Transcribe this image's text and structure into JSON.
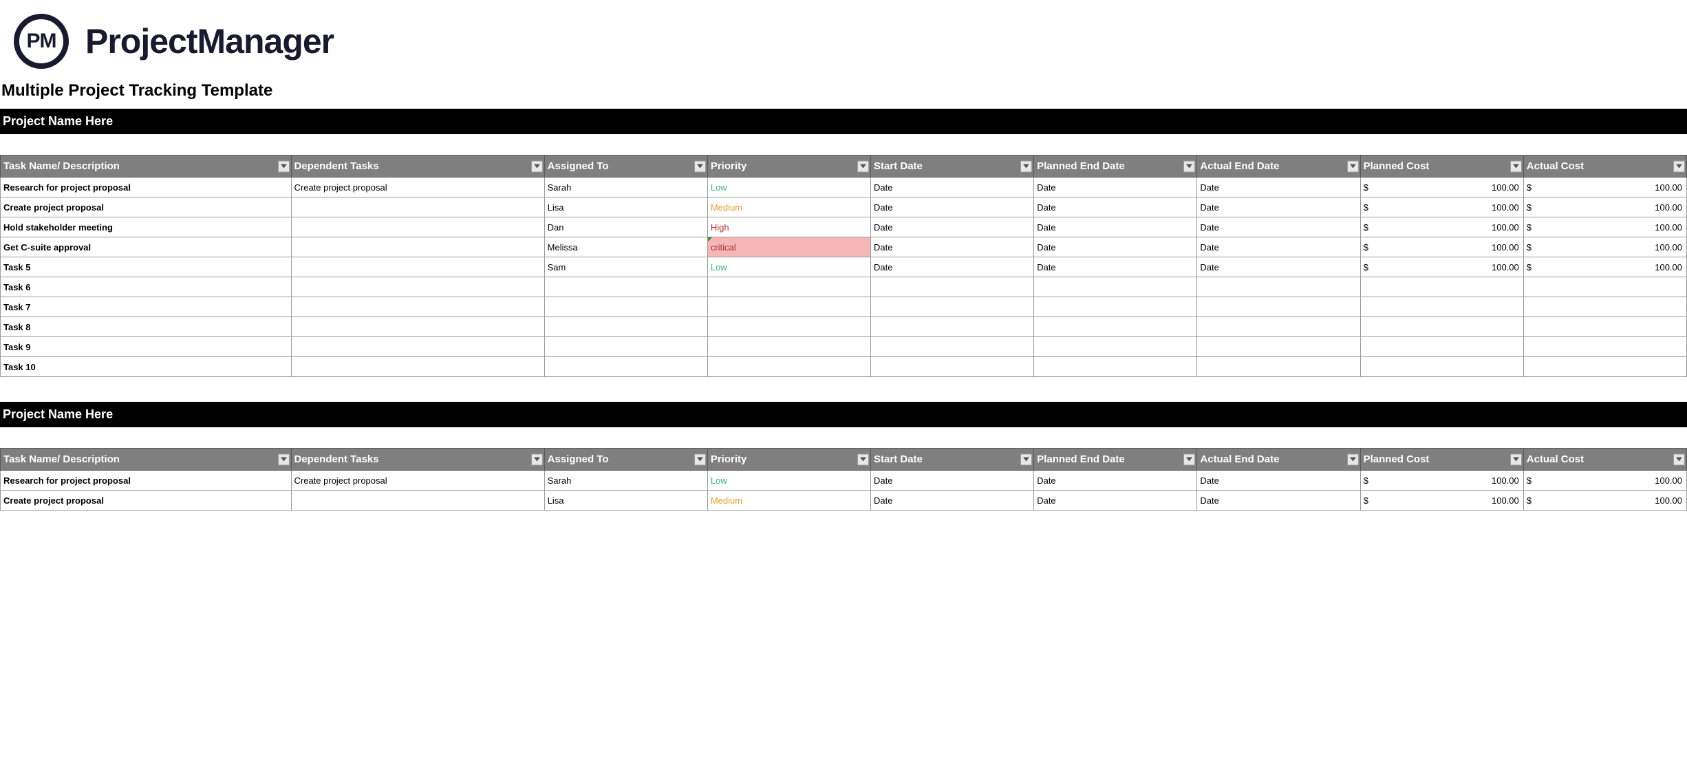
{
  "brand": "ProjectManager",
  "logo_initials": "PM",
  "template_title": "Multiple Project Tracking Template",
  "columns": [
    "Task Name/ Description",
    "Dependent Tasks",
    "Assigned To",
    "Priority",
    "Start Date",
    "Planned End Date",
    "Actual End Date",
    "Planned Cost",
    "Actual Cost"
  ],
  "currency_symbol": "$",
  "projects": [
    {
      "name": "Project Name Here",
      "rows": [
        {
          "task": "Research for project proposal",
          "dependent": "Create project proposal",
          "assigned": "Sarah",
          "priority": "Low",
          "start": "Date",
          "planned_end": "Date",
          "actual_end": "Date",
          "planned_cost": "100.00",
          "actual_cost": "100.00"
        },
        {
          "task": "Create project proposal",
          "dependent": "",
          "assigned": "Lisa",
          "priority": "Medium",
          "start": "Date",
          "planned_end": "Date",
          "actual_end": "Date",
          "planned_cost": "100.00",
          "actual_cost": "100.00"
        },
        {
          "task": "Hold stakeholder meeting",
          "dependent": "",
          "assigned": "Dan",
          "priority": "High",
          "start": "Date",
          "planned_end": "Date",
          "actual_end": "Date",
          "planned_cost": "100.00",
          "actual_cost": "100.00"
        },
        {
          "task": "Get C-suite approval",
          "dependent": "",
          "assigned": "Melissa",
          "priority": "critical",
          "start": "Date",
          "planned_end": "Date",
          "actual_end": "Date",
          "planned_cost": "100.00",
          "actual_cost": "100.00"
        },
        {
          "task": "Task 5",
          "dependent": "",
          "assigned": "Sam",
          "priority": "Low",
          "start": "Date",
          "planned_end": "Date",
          "actual_end": "Date",
          "planned_cost": "100.00",
          "actual_cost": "100.00"
        },
        {
          "task": "Task 6",
          "dependent": "",
          "assigned": "",
          "priority": "",
          "start": "",
          "planned_end": "",
          "actual_end": "",
          "planned_cost": "",
          "actual_cost": ""
        },
        {
          "task": "Task 7",
          "dependent": "",
          "assigned": "",
          "priority": "",
          "start": "",
          "planned_end": "",
          "actual_end": "",
          "planned_cost": "",
          "actual_cost": ""
        },
        {
          "task": "Task 8",
          "dependent": "",
          "assigned": "",
          "priority": "",
          "start": "",
          "planned_end": "",
          "actual_end": "",
          "planned_cost": "",
          "actual_cost": ""
        },
        {
          "task": "Task 9",
          "dependent": "",
          "assigned": "",
          "priority": "",
          "start": "",
          "planned_end": "",
          "actual_end": "",
          "planned_cost": "",
          "actual_cost": ""
        },
        {
          "task": "Task 10",
          "dependent": "",
          "assigned": "",
          "priority": "",
          "start": "",
          "planned_end": "",
          "actual_end": "",
          "planned_cost": "",
          "actual_cost": ""
        }
      ]
    },
    {
      "name": "Project Name Here",
      "rows": [
        {
          "task": "Research for project proposal",
          "dependent": "Create project proposal",
          "assigned": "Sarah",
          "priority": "Low",
          "start": "Date",
          "planned_end": "Date",
          "actual_end": "Date",
          "planned_cost": "100.00",
          "actual_cost": "100.00"
        },
        {
          "task": "Create project proposal",
          "dependent": "",
          "assigned": "Lisa",
          "priority": "Medium",
          "start": "Date",
          "planned_end": "Date",
          "actual_end": "Date",
          "planned_cost": "100.00",
          "actual_cost": "100.00"
        }
      ]
    }
  ]
}
